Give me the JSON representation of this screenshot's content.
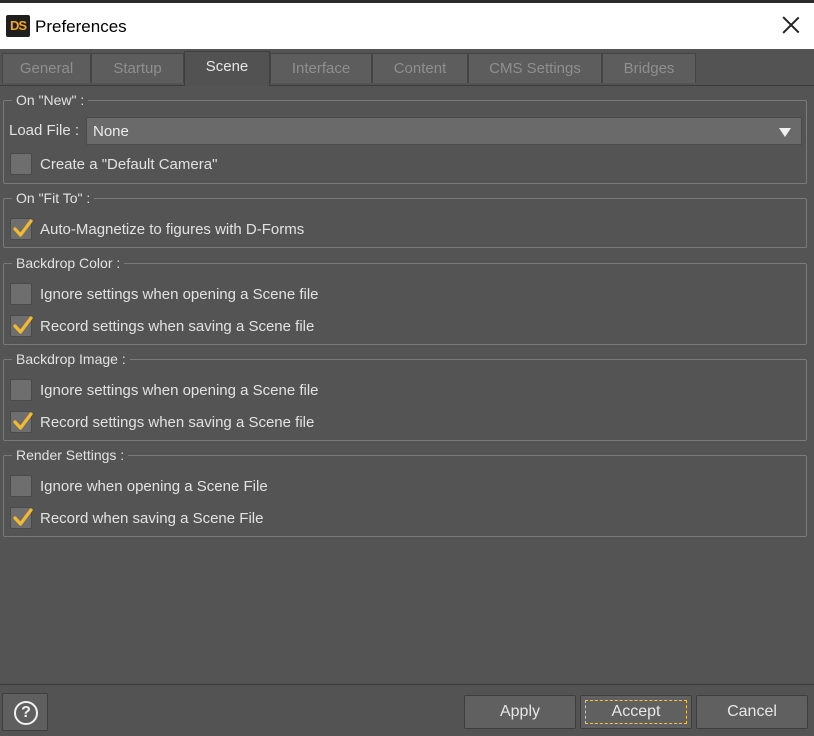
{
  "window": {
    "app_icon_text": "DS",
    "title": "Preferences"
  },
  "tabs": [
    {
      "label": "General"
    },
    {
      "label": "Startup"
    },
    {
      "label": "Scene"
    },
    {
      "label": "Interface"
    },
    {
      "label": "Content"
    },
    {
      "label": "CMS Settings"
    },
    {
      "label": "Bridges"
    }
  ],
  "active_tab": "Scene",
  "groups": {
    "on_new": {
      "title": "On \"New\" :",
      "load_file_label": "Load File :",
      "load_file_value": "None",
      "default_camera_label": "Create a \"Default Camera\"",
      "default_camera_checked": false
    },
    "on_fit_to": {
      "title": "On \"Fit To\" :",
      "auto_magnetize_label": "Auto-Magnetize to figures with D-Forms",
      "auto_magnetize_checked": true
    },
    "backdrop_color": {
      "title": "Backdrop Color :",
      "ignore_label": "Ignore settings when opening a Scene file",
      "ignore_checked": false,
      "record_label": "Record settings when saving a Scene file",
      "record_checked": true
    },
    "backdrop_image": {
      "title": "Backdrop Image :",
      "ignore_label": "Ignore settings when opening a Scene file",
      "ignore_checked": false,
      "record_label": "Record settings when saving a Scene file",
      "record_checked": true
    },
    "render_settings": {
      "title": "Render Settings :",
      "ignore_label": "Ignore when opening a Scene File",
      "ignore_checked": false,
      "record_label": "Record when saving a Scene File",
      "record_checked": true
    }
  },
  "footer": {
    "help_glyph": "?",
    "apply_label": "Apply",
    "accept_label": "Accept",
    "cancel_label": "Cancel"
  },
  "colors": {
    "checkmark": "#f5b82e",
    "focus_ring": "#f5c242",
    "panel_bg": "#545454"
  },
  "icons": {
    "app": "daz-studio-logo-icon",
    "close": "close-icon",
    "dropdown": "chevron-down-icon",
    "help": "help-icon",
    "check": "checkmark-icon"
  }
}
